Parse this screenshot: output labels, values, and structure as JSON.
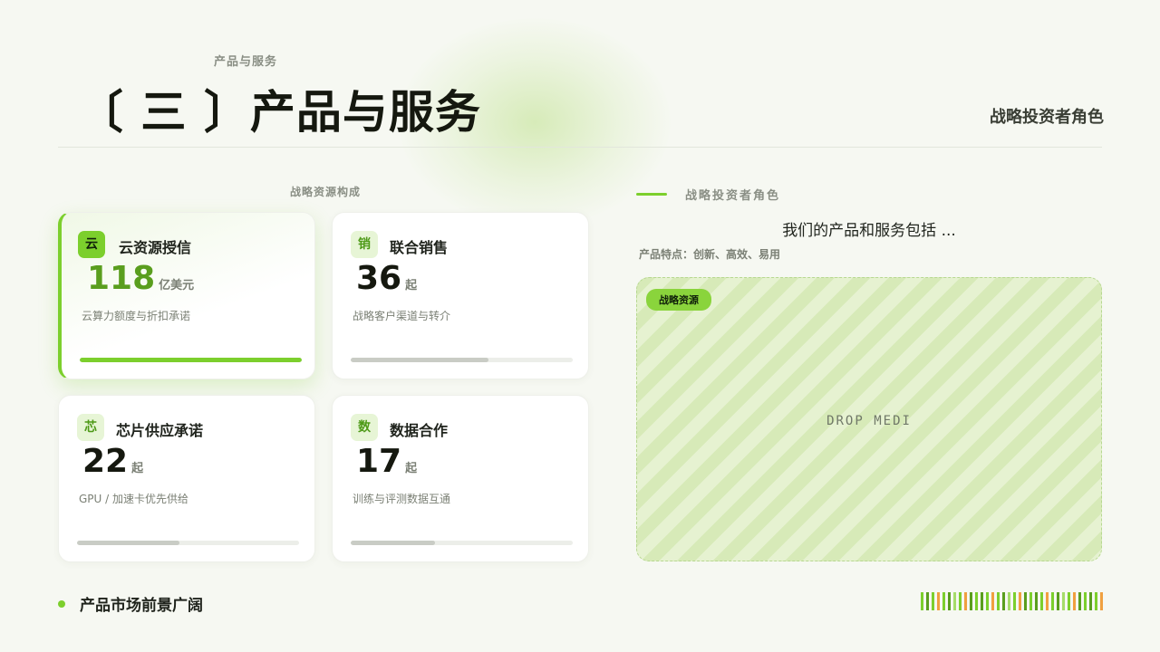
{
  "header": {
    "kicker": "产品与服务",
    "title": "〔 三 〕产品与服务",
    "role": "战略投资者角色"
  },
  "left": {
    "section_label": "战略资源构成",
    "cards": [
      {
        "badge": "云",
        "title": "云资源授信",
        "number": "118",
        "unit": "亿美元",
        "desc": "云算力额度与折扣承诺",
        "progress": 1.0,
        "active": true
      },
      {
        "badge": "销",
        "title": "联合销售",
        "number": "36",
        "unit": "起",
        "desc": "战略客户渠道与转介",
        "progress": 0.62,
        "active": false
      },
      {
        "badge": "芯",
        "title": "芯片供应承诺",
        "number": "22",
        "unit": "起",
        "desc": "GPU /  加速卡优先供给",
        "progress": 0.46,
        "active": false
      },
      {
        "badge": "数",
        "title": "数据合作",
        "number": "17",
        "unit": "起",
        "desc": "训练与评测数据互通",
        "progress": 0.38,
        "active": false
      }
    ]
  },
  "right": {
    "heading": "战略投资者角色",
    "subtitle": "我们的产品和服务包括 ...",
    "features": "产品特点：创新、高效、易用",
    "media_tag": "战略资源",
    "media_placeholder": "DROP MEDI"
  },
  "footer": {
    "text": "产品市场前景广阔"
  },
  "colors": {
    "accent": "#7ccf2d",
    "accent_dark": "#5a9e1e",
    "stripe_orange": "#f0a040"
  }
}
